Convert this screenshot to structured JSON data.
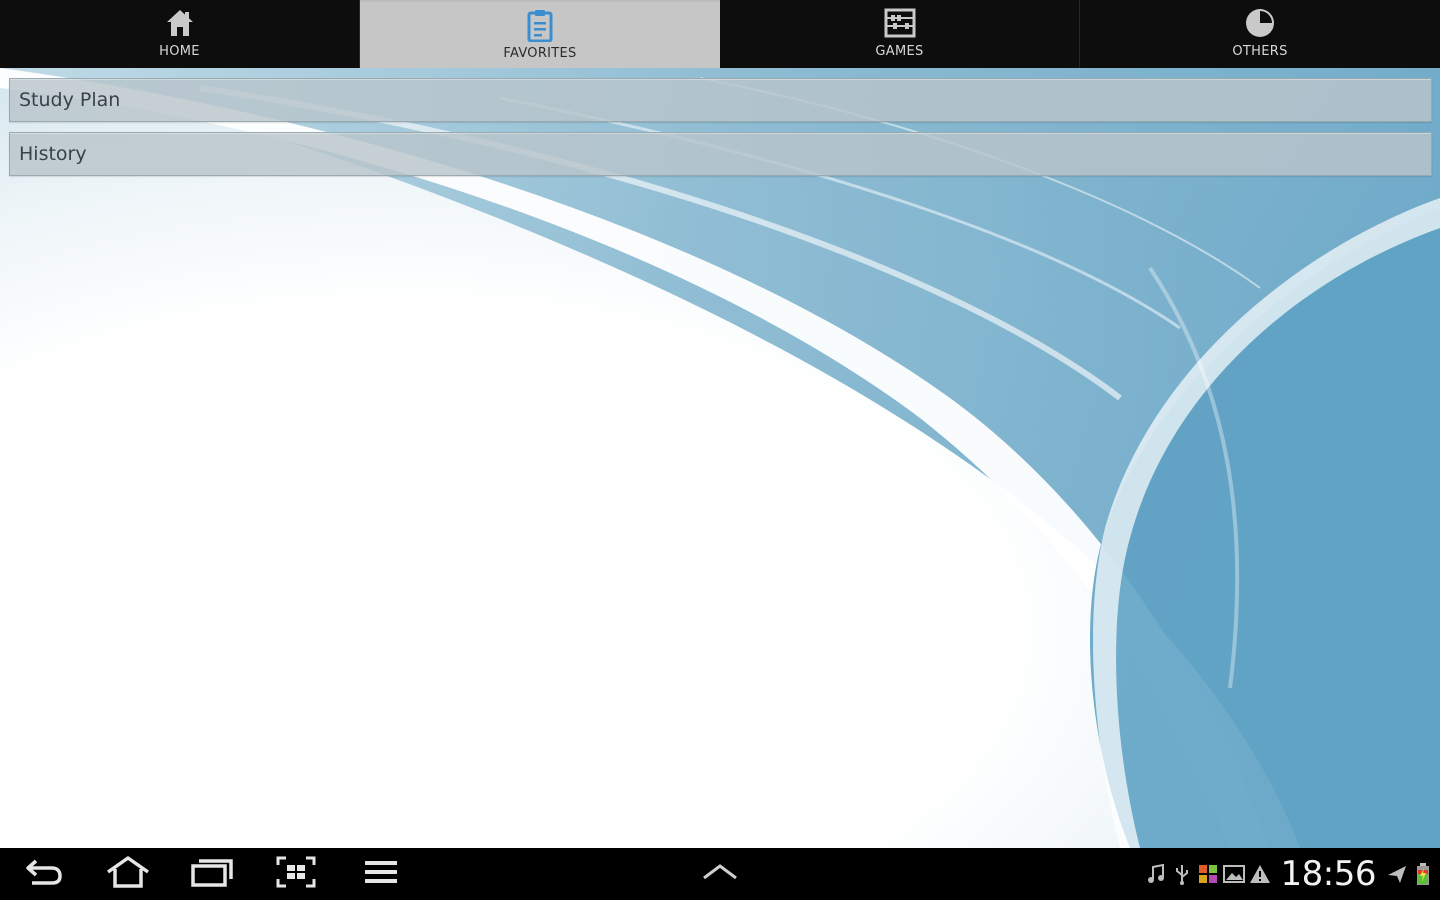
{
  "tabs": [
    {
      "label": "HOME",
      "icon": "home-icon",
      "active": false
    },
    {
      "label": "FAVORITES",
      "icon": "clipboard-icon",
      "active": true
    },
    {
      "label": "GAMES",
      "icon": "abacus-icon",
      "active": false
    },
    {
      "label": "OTHERS",
      "icon": "pie-icon",
      "active": false
    }
  ],
  "list": {
    "items": [
      {
        "label": "Study Plan"
      },
      {
        "label": "History"
      }
    ]
  },
  "system_bar": {
    "buttons": [
      "back-icon",
      "home-icon",
      "recent-apps-icon",
      "screenshot-icon",
      "menu-icon",
      "chevron-up-icon"
    ],
    "status_icons": [
      "music-icon",
      "usb-icon",
      "apps-grid-icon",
      "gallery-icon",
      "warning-icon"
    ],
    "clock": "18:56",
    "status_right_icons": [
      "airplane-icon",
      "battery-charging-icon"
    ]
  },
  "colors": {
    "tabbar_bg": "#0d0d0d",
    "tab_active_bg": "#c6c6c6",
    "active_icon": "#3a8ed0",
    "list_item_bg": "#b8c4cb",
    "wallpaper_blue": "#5fa2c4",
    "sysbar_bg": "#000000"
  }
}
